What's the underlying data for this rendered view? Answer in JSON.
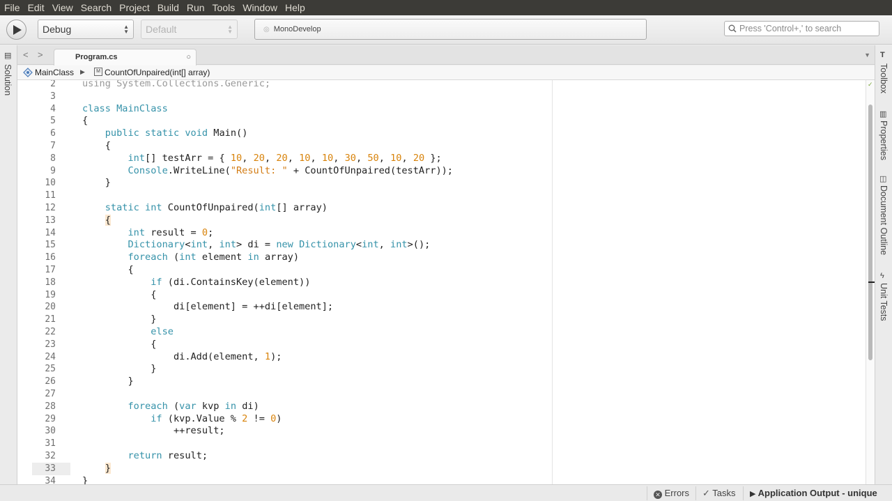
{
  "menu": [
    "File",
    "Edit",
    "View",
    "Search",
    "Project",
    "Build",
    "Run",
    "Tools",
    "Window",
    "Help"
  ],
  "toolbar": {
    "configuration": "Debug",
    "target": "Default",
    "status_text": "MonoDevelop",
    "search_placeholder": "Press 'Control+,' to search"
  },
  "left_dock": {
    "solution_label": "Solution"
  },
  "right_dock": {
    "toolbox_label": "Toolbox",
    "properties_label": "Properties",
    "document_outline_label": "Document Outline",
    "unit_tests_label": "Unit Tests"
  },
  "tabs": {
    "active_tab": "Program.cs"
  },
  "breadcrumb": {
    "class_name": "MainClass",
    "method_name": "CountOfUnpaired(int[] array)"
  },
  "editor": {
    "current_line": 33,
    "lines": [
      {
        "n": "2",
        "html": "<span style='color:#999'>using System.Collections.Generic;</span>"
      },
      {
        "n": "3",
        "html": ""
      },
      {
        "n": "4",
        "html": "<span class='kw'>class</span> <span class='ty'>MainClass</span>"
      },
      {
        "n": "5",
        "html": "{"
      },
      {
        "n": "6",
        "html": "    <span class='kw'>public</span> <span class='kw'>static</span> <span class='kw'>void</span> Main()"
      },
      {
        "n": "7",
        "html": "    {"
      },
      {
        "n": "8",
        "html": "        <span class='kw'>int</span>[] testArr = { <span class='num'>10</span>, <span class='num'>20</span>, <span class='num'>20</span>, <span class='num'>10</span>, <span class='num'>10</span>, <span class='num'>30</span>, <span class='num'>50</span>, <span class='num'>10</span>, <span class='num'>20</span> };"
      },
      {
        "n": "9",
        "html": "        <span class='ty'>Console</span>.WriteLine(<span class='str'>\"Result: \"</span> + CountOfUnpaired(testArr));"
      },
      {
        "n": "10",
        "html": "    }"
      },
      {
        "n": "11",
        "html": ""
      },
      {
        "n": "12",
        "html": "    <span class='kw'>static</span> <span class='kw'>int</span> CountOfUnpaired(<span class='kw'>int</span>[] array)"
      },
      {
        "n": "13",
        "html": "    <span class='brace-hl'>{</span>"
      },
      {
        "n": "14",
        "html": "        <span class='kw'>int</span> result = <span class='num'>0</span>;"
      },
      {
        "n": "15",
        "html": "        <span class='ty'>Dictionary</span>&lt;<span class='kw'>int</span>, <span class='kw'>int</span>&gt; di = <span class='kw'>new</span> <span class='ty'>Dictionary</span>&lt;<span class='kw'>int</span>, <span class='kw'>int</span>&gt;();"
      },
      {
        "n": "16",
        "html": "        <span class='kw'>foreach</span> (<span class='kw'>int</span> element <span class='kw'>in</span> array)"
      },
      {
        "n": "17",
        "html": "        {"
      },
      {
        "n": "18",
        "html": "            <span class='kw'>if</span> (di.ContainsKey(element))"
      },
      {
        "n": "19",
        "html": "            {"
      },
      {
        "n": "20",
        "html": "                di[element] = ++di[element];"
      },
      {
        "n": "21",
        "html": "            }"
      },
      {
        "n": "22",
        "html": "            <span class='kw'>else</span>"
      },
      {
        "n": "23",
        "html": "            {"
      },
      {
        "n": "24",
        "html": "                di.Add(element, <span class='num'>1</span>);"
      },
      {
        "n": "25",
        "html": "            }"
      },
      {
        "n": "26",
        "html": "        }"
      },
      {
        "n": "27",
        "html": ""
      },
      {
        "n": "28",
        "html": "        <span class='kw'>foreach</span> (<span class='kw'>var</span> kvp <span class='kw'>in</span> di)"
      },
      {
        "n": "29",
        "html": "            <span class='kw'>if</span> (kvp.Value % <span class='num'>2</span> != <span class='num'>0</span>)"
      },
      {
        "n": "30",
        "html": "                ++result;"
      },
      {
        "n": "31",
        "html": ""
      },
      {
        "n": "32",
        "html": "        <span class='kw'>return</span> result;"
      },
      {
        "n": "33",
        "html": "    <span class='brace-hl'>}</span>"
      },
      {
        "n": "34",
        "html": "}"
      }
    ]
  },
  "statusbar": {
    "errors_label": "Errors",
    "tasks_label": "Tasks",
    "output_label": "Application Output - unique"
  },
  "colors": {
    "keyword": "#3592a9",
    "number": "#d8830b",
    "string": "#d37c14",
    "menubar": "#3c3b37"
  }
}
